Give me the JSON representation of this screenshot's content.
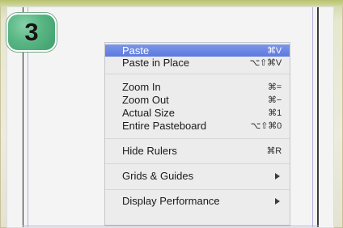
{
  "step": {
    "number": "3"
  },
  "menu": {
    "items": [
      {
        "label": "Paste",
        "shortcut": "⌘V",
        "selected": true
      },
      {
        "label": "Paste in Place",
        "shortcut": "⌥⇧⌘V"
      },
      {
        "label": "Zoom In",
        "shortcut": "⌘="
      },
      {
        "label": "Zoom Out",
        "shortcut": "⌘−"
      },
      {
        "label": "Actual Size",
        "shortcut": "⌘1"
      },
      {
        "label": "Entire Pasteboard",
        "shortcut": "⌥⇧⌘0"
      },
      {
        "label": "Hide Rulers",
        "shortcut": "⌘R"
      },
      {
        "label": "Grids & Guides",
        "submenu": true
      },
      {
        "label": "Display Performance",
        "submenu": true
      }
    ]
  },
  "colors": {
    "selection": "#6482e2",
    "badge": "#58b683",
    "page_guides": "#b7b1d7"
  }
}
